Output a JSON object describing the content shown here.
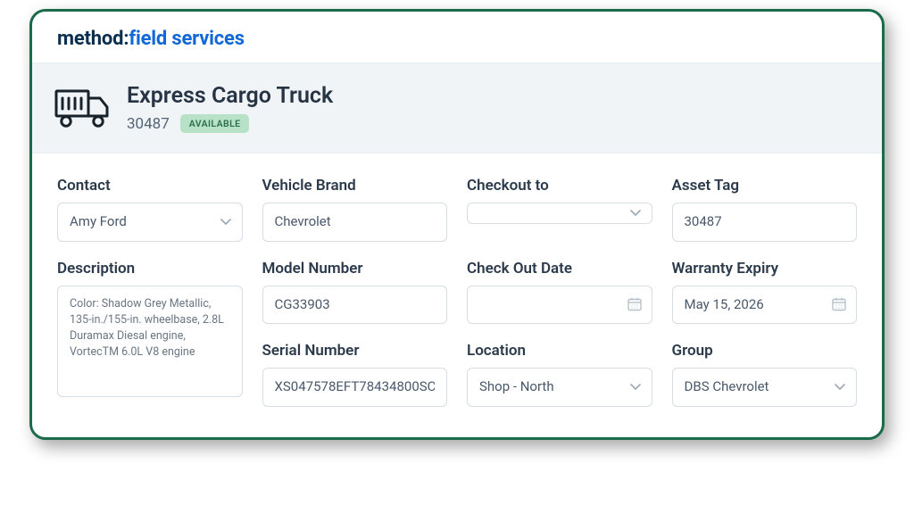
{
  "brand": {
    "part_a": "method",
    "colon": ":",
    "part_b": "field services"
  },
  "header": {
    "title": "Express Cargo Truck",
    "asset_id": "30487",
    "status_badge": "AVAILABLE"
  },
  "fields": {
    "contact": {
      "label": "Contact",
      "value": "Amy Ford"
    },
    "vehicle_brand": {
      "label": "Vehicle Brand",
      "value": "Chevrolet"
    },
    "checkout_to": {
      "label": "Checkout to",
      "value": ""
    },
    "asset_tag": {
      "label": "Asset Tag",
      "value": "30487"
    },
    "description": {
      "label": "Description",
      "value": "Color: Shadow Grey Metallic, 135-in./155-in. wheelbase, 2.8L Duramax Diesal engine, VortecTM 6.0L V8 engine"
    },
    "model_number": {
      "label": "Model Number",
      "value": "CG33903"
    },
    "checkout_date": {
      "label": "Check Out Date",
      "value": ""
    },
    "warranty_expiry": {
      "label": "Warranty Expiry",
      "value": "May 15, 2026"
    },
    "serial_number": {
      "label": "Serial Number",
      "value": "XS047578EFT78434800SC"
    },
    "location": {
      "label": "Location",
      "value": "Shop - North"
    },
    "group": {
      "label": "Group",
      "value": "DBS Chevrolet"
    }
  }
}
